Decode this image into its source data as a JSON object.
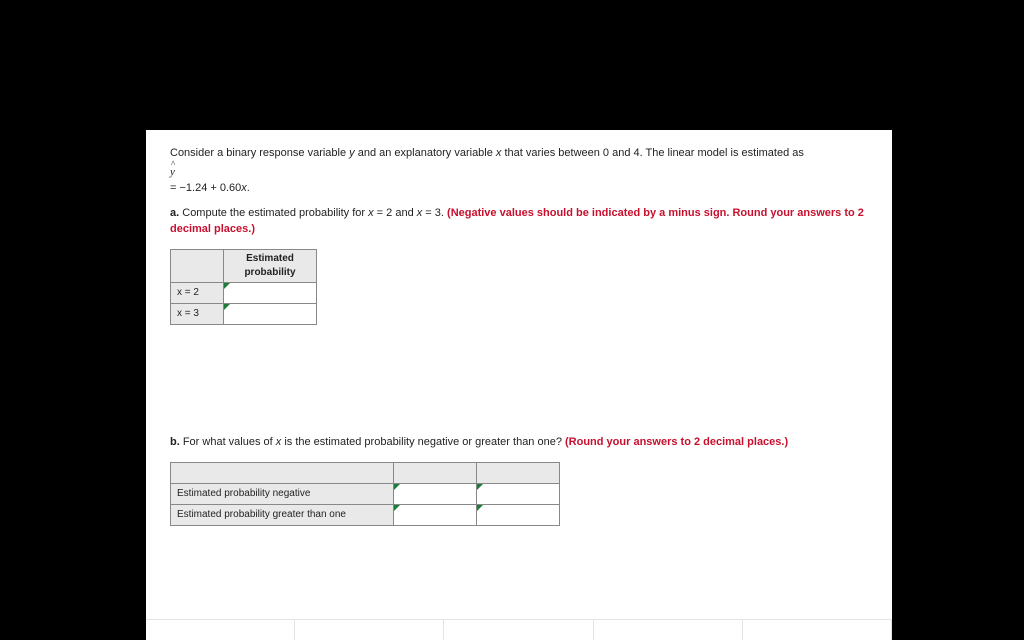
{
  "intro": {
    "text1": "Consider a binary response variable ",
    "var_y": "y",
    "text2": " and an explanatory variable ",
    "var_x": "x",
    "text3": " that varies between 0 and 4. The linear model is estimated as",
    "formula": "= −1.24 + 0.60",
    "formula_var": "x",
    "formula_end": "."
  },
  "part_a": {
    "label": "a.",
    "text1": " Compute the estimated probability for ",
    "eq1": "x",
    "eq1b": " = 2 and ",
    "eq2": "x",
    "eq2b": " = 3. ",
    "red": "(Negative values should be indicated by a minus sign. Round your answers to 2 decimal places.)",
    "table": {
      "header": "Estimated probability",
      "rows": [
        {
          "label": "x = 2",
          "value": ""
        },
        {
          "label": "x = 3",
          "value": ""
        }
      ]
    }
  },
  "part_b": {
    "label": "b.",
    "text1": " For what values of ",
    "var_x": "x",
    "text2": " is the estimated probability negative or greater than one? ",
    "red": "(Round your answers to 2 decimal places.)",
    "table": {
      "rows": [
        {
          "label": "Estimated probability negative",
          "v1": "",
          "v2": ""
        },
        {
          "label": "Estimated probability greater than one",
          "v1": "",
          "v2": ""
        }
      ]
    }
  }
}
